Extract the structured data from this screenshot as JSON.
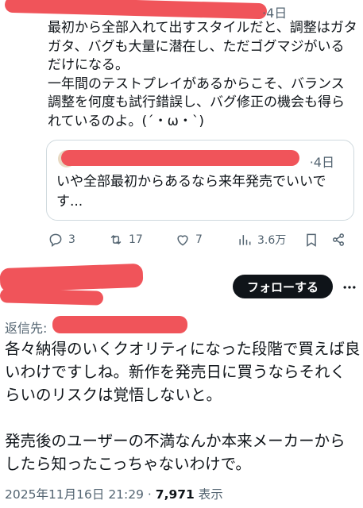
{
  "tweet1": {
    "date_suffix": "·4日",
    "body": "最初から全部入れて出すスタイルだと、調整はガタガタ、バグも大量に潜在し、ただゴグマジがいるだけになる。\n一年間のテストプレイがあるからこそ、バランス調整を何度も試行錯誤し、バグ修正の機会も得られているのよ。(´・ω・`)"
  },
  "quote": {
    "date_suffix": "·4日",
    "body": "いや全部最初からあるなら来年発売でいいです..."
  },
  "actions": {
    "replies": "3",
    "retweets": "17",
    "likes": "7",
    "views": "3.6万"
  },
  "tweet2": {
    "follow_label": "フォローする",
    "reply_to_label": "返信先:",
    "body": "各々納得のいくクオリティになった段階で買えば良いわけですしね。新作を発売日に買うならそれくらいのリスクは覚悟しないと。\n\n発売後のユーザーの不満なんか本来メーカーからしたら知ったこっちゃないわけで。",
    "timestamp": "2025年11月16日 21:29 · ",
    "view_count": "7,971",
    "view_label": " 表示"
  },
  "colors": {
    "redaction": "#f0545a",
    "secondary_text": "#536471",
    "follow_bg": "#0f1419"
  },
  "icons": [
    "reply-icon",
    "retweet-icon",
    "like-icon",
    "views-icon",
    "bookmark-icon",
    "share-icon",
    "more-icon"
  ]
}
